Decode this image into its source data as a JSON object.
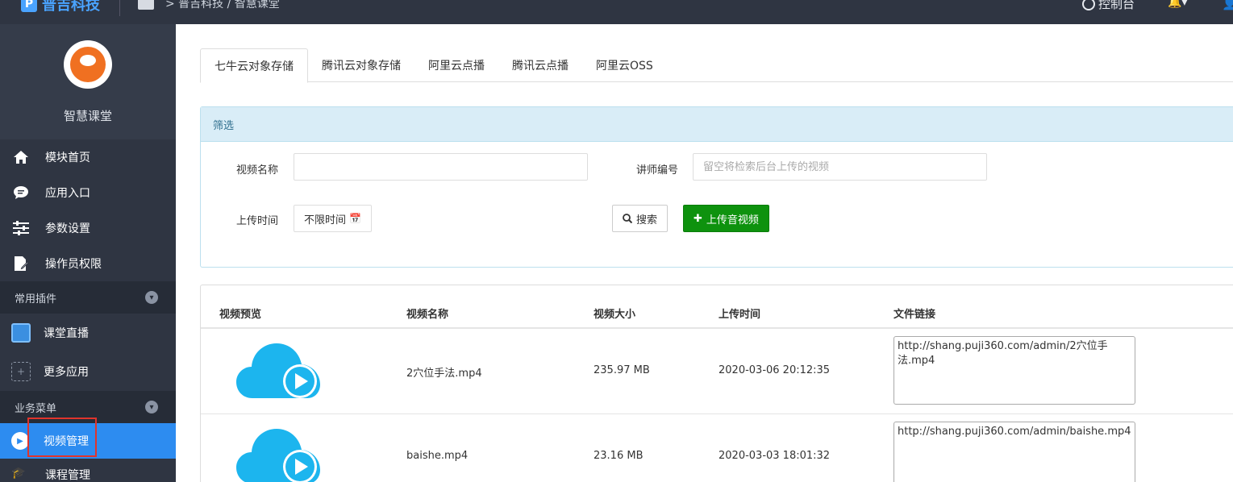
{
  "header": {
    "brand": "普吉科技",
    "breadcrumb": "> 普吉科技 / 智慧课堂",
    "console_label": "控制台"
  },
  "sidebar": {
    "profile_name": "智慧课堂",
    "items": [
      {
        "label": "模块首页",
        "icon": "home-icon"
      },
      {
        "label": "应用入口",
        "icon": "chat-icon"
      },
      {
        "label": "参数设置",
        "icon": "sliders-icon"
      },
      {
        "label": "操作员权限",
        "icon": "document-edit-icon"
      }
    ],
    "section_plugins": "常用插件",
    "plugins": [
      {
        "label": "课堂直播",
        "icon": "live-icon"
      },
      {
        "label": "更多应用",
        "icon": "plus-icon"
      }
    ],
    "section_business": "业务菜单",
    "active_item": "视频管理",
    "next_item": "课程管理"
  },
  "tabs": [
    "七牛云对象存储",
    "腾讯云对象存储",
    "阿里云点播",
    "腾讯云点播",
    "阿里云OSS"
  ],
  "filter": {
    "title": "筛选",
    "video_name_label": "视频名称",
    "video_name_value": "",
    "teacher_label": "讲师编号",
    "teacher_placeholder": "留空将检索后台上传的视频",
    "upload_time_label": "上传时间",
    "upload_time_value": "不限时间",
    "search_button": "搜索",
    "upload_button": "上传音视频"
  },
  "table": {
    "headers": [
      "视频预览",
      "视频名称",
      "视频大小",
      "上传时间",
      "文件链接"
    ],
    "rows": [
      {
        "name": "2穴位手法.mp4",
        "size": "235.97 MB",
        "time": "2020-03-06 20:12:35",
        "link": "http://shang.puji360.com/admin/2穴位手法.mp4"
      },
      {
        "name": "baishe.mp4",
        "size": "23.16 MB",
        "time": "2020-03-03 18:01:32",
        "link": "http://shang.puji360.com/admin/baishe.mp4"
      }
    ]
  },
  "colors": {
    "sidebar_bg": "#2f3542",
    "active_blue": "#2d8cf0",
    "upload_green": "#0e920e",
    "cloud_blue": "#1cb5ee",
    "highlight_red": "#e0342c"
  }
}
